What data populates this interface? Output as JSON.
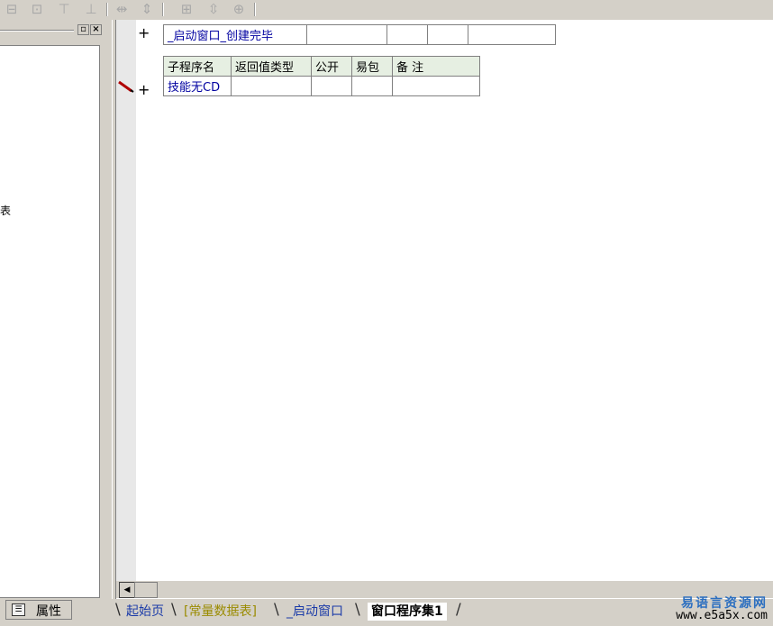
{
  "toolbar": {
    "icons": [
      "align-left-icon",
      "align-center-icon",
      "align-top-icon",
      "align-bottom-icon",
      "same-width-icon",
      "same-height-icon",
      "hcenter-icon",
      "vcenter-icon",
      "center-both-icon"
    ]
  },
  "left_panel": {
    "partial_text": "表",
    "properties_tab": "属性"
  },
  "editor": {
    "event_row": {
      "name": "_启动窗口_创建完毕"
    },
    "sub_header": [
      "子程序名",
      "返回值类型",
      "公开",
      "易包",
      "备 注"
    ],
    "sub_row": {
      "name": "技能无CD"
    }
  },
  "tabs": [
    {
      "label": "起始页",
      "color": "#1a3aa8"
    },
    {
      "label": "[常量数据表]",
      "color": "#9a8b00"
    },
    {
      "label": "_启动窗口",
      "color": "#1a3aa8"
    },
    {
      "label": "窗口程序集1",
      "color": "#000000",
      "active": true
    }
  ],
  "watermark": {
    "site_name": "易语言资源网",
    "url": "www.e5a5x.com"
  }
}
